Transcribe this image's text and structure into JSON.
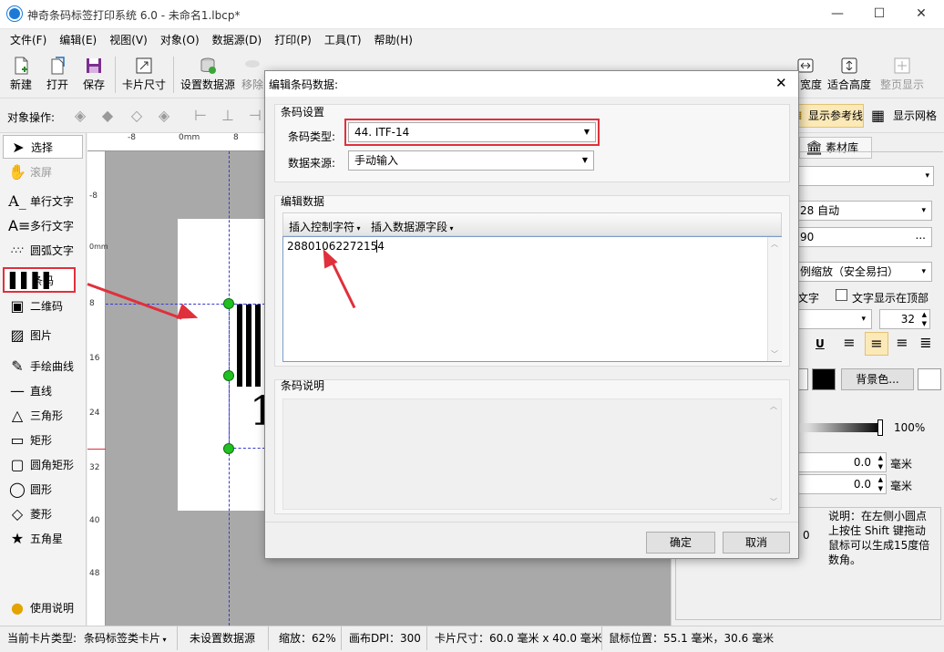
{
  "window": {
    "title": "神奇条码标签打印系统 6.0 - 未命名1.lbcp*",
    "minimize": "—",
    "maximize": "☐",
    "close": "✕"
  },
  "menu": [
    "文件(F)",
    "编辑(E)",
    "视图(V)",
    "对象(O)",
    "数据源(D)",
    "打印(P)",
    "工具(T)",
    "帮助(H)"
  ],
  "toolbar": {
    "new": "新建",
    "open": "打开",
    "save": "保存",
    "card_size": "卡片尺寸",
    "set_datasource": "设置数据源",
    "remove": "移除",
    "width": "宽度",
    "fit_height": "适合高度",
    "full_page": "整页显示"
  },
  "opsbar": {
    "label": "对象操作:",
    "show_guides": "显示参考线",
    "show_grid": "显示网格"
  },
  "tools": [
    "选择",
    "滚屏",
    "单行文字",
    "多行文字",
    "圆弧文字",
    "条码",
    "二维码",
    "图片",
    "手绘曲线",
    "直线",
    "三角形",
    "矩形",
    "圆角矩形",
    "圆形",
    "菱形",
    "五角星",
    "使用说明"
  ],
  "ruler": {
    "h": [
      "-8",
      "0mm",
      "8"
    ],
    "v": [
      "-8",
      "0mm",
      "8",
      "16",
      "24",
      "32",
      "40",
      "48"
    ]
  },
  "canvas": {
    "card_digit": "1"
  },
  "rightpanel": {
    "tab_library": "素材库",
    "auto_field": "28 自动",
    "value_field": "90",
    "ellipsis": "...",
    "scale_mode": "例缩放（安全易扫）",
    "text_label": "文字",
    "text_on_top": "文字显示在顶部",
    "font_size": "32",
    "bold_u": "U",
    "bg_color": "背景色...",
    "opacity": "100%",
    "x_value": "0.0",
    "y_value": "0.0",
    "unit": "毫米",
    "rotation": "0",
    "hint": "说明：在左侧小圆点上按住 Shift 键拖动鼠标可以生成15度倍数角。"
  },
  "status": {
    "card_type_label": "当前卡片类型:",
    "card_type": "条码标签类卡片",
    "datasource": "未设置数据源",
    "zoom": "缩放：62%",
    "dpi": "画布DPI：300",
    "size": "卡片尺寸：60.0 毫米 x 40.0 毫米",
    "mouse": "鼠标位置：55.1 毫米，30.6 毫米"
  },
  "dialog": {
    "title": "编辑条码数据:",
    "close": "✕",
    "group_settings": "条码设置",
    "type_label": "条码类型:",
    "type_value": "44. ITF-14",
    "source_label": "数据来源:",
    "source_value": "手动输入",
    "group_edit": "编辑数据",
    "insert_control": "插入控制字符",
    "insert_field": "插入数据源字段",
    "data_value": "28801062272154",
    "group_desc": "条码说明",
    "ok": "确定",
    "cancel": "取消"
  }
}
